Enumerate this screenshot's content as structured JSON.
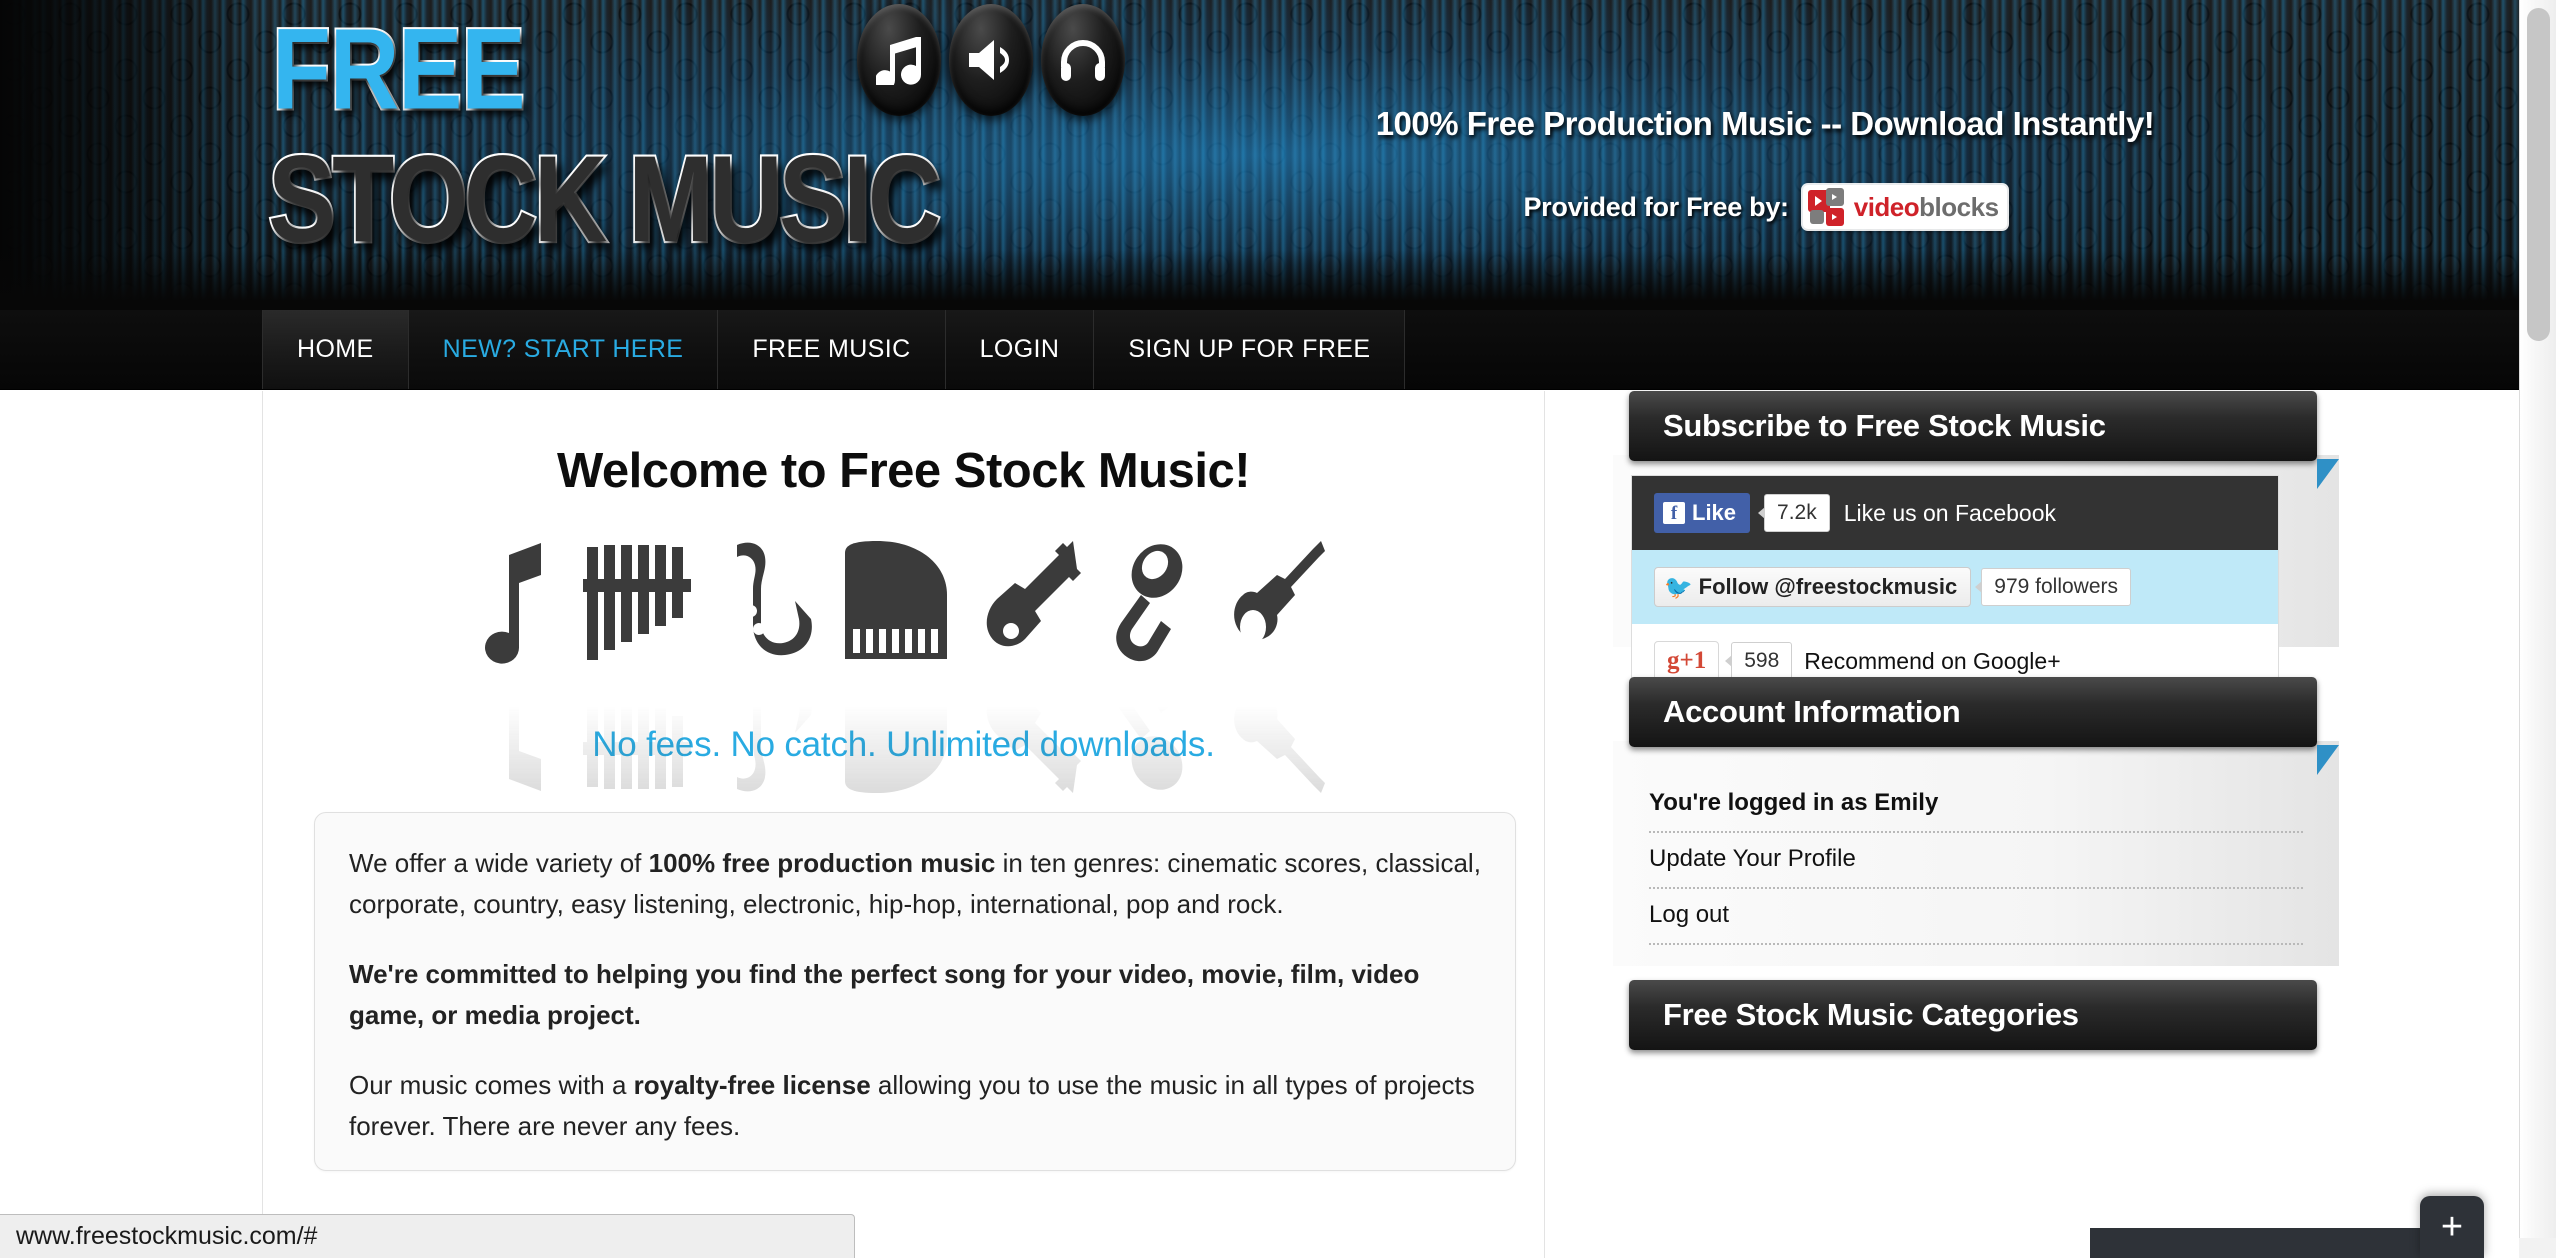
{
  "header": {
    "logo_line1": "FREE",
    "logo_line2": "STOCK MUSIC",
    "badges": [
      "music-note-icon",
      "speaker-icon",
      "headphones-icon"
    ],
    "tagline": "100% Free Production Music -- Download Instantly!",
    "provided_by_label": "Provided for Free by:",
    "sponsor_name_part1": "video",
    "sponsor_name_part2": "blocks",
    "accent_blue": "#34b5ef"
  },
  "nav": {
    "items": [
      {
        "label": "HOME",
        "active": true,
        "accent": false
      },
      {
        "label": "NEW? START HERE",
        "active": false,
        "accent": true
      },
      {
        "label": "FREE MUSIC",
        "active": false,
        "accent": false
      },
      {
        "label": "LOGIN",
        "active": false,
        "accent": false
      },
      {
        "label": "SIGN UP FOR FREE",
        "active": false,
        "accent": false
      }
    ]
  },
  "main": {
    "welcome_title": "Welcome to Free Stock Music!",
    "instrument_icons": [
      "music-note-icon",
      "pan-flute-icon",
      "saxophone-icon",
      "grand-piano-icon",
      "electric-guitar-icon",
      "microphone-icon",
      "violin-icon"
    ],
    "subtitle": "No fees. No catch. Unlimited downloads.",
    "subtitle_color": "#29abe2",
    "paragraphs": [
      {
        "parts": [
          {
            "text": "We offer a wide variety of ",
            "bold": false
          },
          {
            "text": "100% free production music",
            "bold": true
          },
          {
            "text": " in ten genres: cinematic scores, classical, corporate, country, easy listening, electronic, hip-hop, international, pop and rock.",
            "bold": false
          }
        ]
      },
      {
        "parts": [
          {
            "text": "We're committed to helping you find the perfect song for your video, movie, film, video game, or media project.",
            "bold": true
          }
        ]
      },
      {
        "parts": [
          {
            "text": "Our music comes with a ",
            "bold": false
          },
          {
            "text": "royalty-free license",
            "bold": true
          },
          {
            "text": " allowing you to use the music in all types of projects forever. There are never any fees.",
            "bold": false
          }
        ]
      }
    ]
  },
  "sidebar": {
    "subscribe_panel": {
      "title": "Subscribe to Free Stock Music",
      "facebook": {
        "button_label": "Like",
        "count": "7.2k",
        "caption": "Like us on Facebook",
        "icon": "facebook-icon"
      },
      "twitter": {
        "button_label": "Follow @freestockmusic",
        "count": "979 followers",
        "icon": "twitter-bird-icon"
      },
      "google": {
        "button_label": "+1",
        "count": "598",
        "caption": "Recommend on Google+",
        "icon": "google-plus-icon"
      }
    },
    "account_panel": {
      "title": "Account Information",
      "rows": [
        "You're logged in as Emily",
        "Update Your Profile",
        "Log out"
      ]
    },
    "categories_panel": {
      "title": "Free Stock Music Categories"
    }
  },
  "browser": {
    "status_url": "www.freestockmusic.com/#",
    "fab_label": "+"
  }
}
